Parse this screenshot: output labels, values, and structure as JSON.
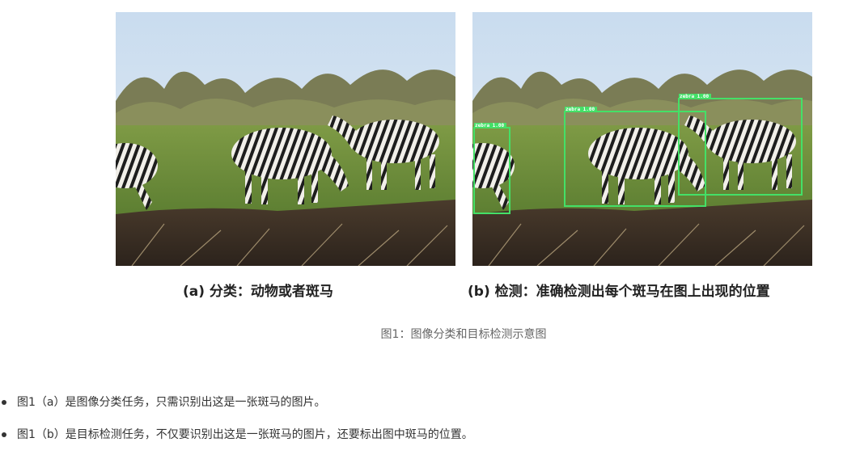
{
  "figure": {
    "panel_a": {
      "caption": "(a) 分类：动物或者斑马"
    },
    "panel_b": {
      "caption": "(b) 检测：准确检测出每个斑马在图上出现的位置",
      "detections": [
        {
          "label": "zebra 1.00"
        },
        {
          "label": "zebra 1.00"
        },
        {
          "label": "zebra 1.00"
        }
      ]
    },
    "caption": "图1：图像分类和目标检测示意图"
  },
  "list": {
    "items": [
      "图1（a）是图像分类任务，只需识别出这是一张斑马的图片。",
      "图1（b）是目标检测任务，不仅要识别出这是一张斑马的图片，还要标出图中斑马的位置。"
    ]
  },
  "colors": {
    "box": "#44e067",
    "sky": "#cfe0ef",
    "grass": "#6f8f3e",
    "soil": "#3b2f25"
  }
}
